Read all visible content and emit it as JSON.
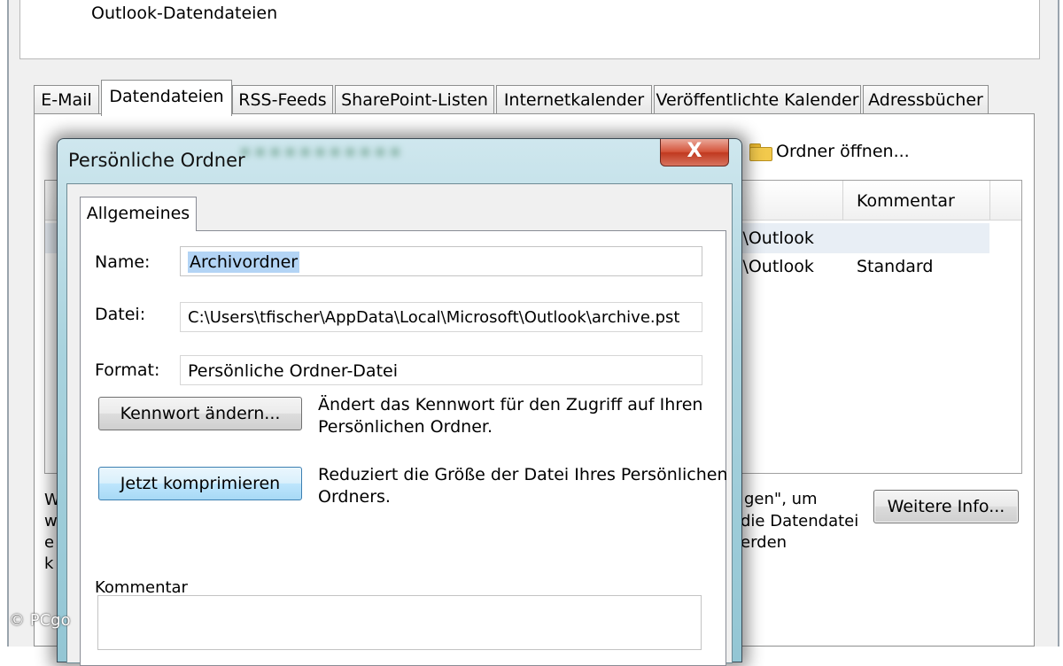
{
  "background_window": {
    "header_title": "Outlook-Datendateien",
    "tabs": [
      {
        "label": "E-Mail"
      },
      {
        "label": "Datendateien"
      },
      {
        "label": "RSS-Feeds"
      },
      {
        "label": "SharePoint-Listen"
      },
      {
        "label": "Internetkalender"
      },
      {
        "label": "Veröffentlichte Kalender"
      },
      {
        "label": "Adressbücher"
      }
    ],
    "active_tab": "Datendateien",
    "toolbar": {
      "open_folder_label": "Ordner öffnen..."
    },
    "list": {
      "column_comment": "Kommentar",
      "rows": [
        {
          "path_fragment": "t\\Outlook",
          "comment": ""
        },
        {
          "path_fragment": "t\\Outlook",
          "comment": "Standard"
        }
      ]
    },
    "info_fragments": {
      "line1": "gen\", um",
      "line2": "die Datendatei",
      "line3": "erden"
    },
    "left_fragments": [
      "W",
      "w",
      "e",
      "k"
    ],
    "more_info_button": "Weitere Info..."
  },
  "dialog": {
    "title": "Persönliche Ordner",
    "close_symbol": "X",
    "tab": "Allgemeines",
    "name_label": "Name:",
    "name_value": "Archivordner",
    "file_label": "Datei:",
    "file_value": "C:\\Users\\tfischer\\AppData\\Local\\Microsoft\\Outlook\\archive.pst",
    "format_label": "Format:",
    "format_value": "Persönliche Ordner-Datei",
    "change_password_button": "Kennwort ändern...",
    "change_password_desc_1": "Ändert das Kennwort für den Zugriff auf Ihren",
    "change_password_desc_2": "Persönlichen Ordner.",
    "compact_button": "Jetzt komprimieren",
    "compact_desc_1": "Reduziert die Größe der Datei Ihres Persönlichen",
    "compact_desc_2": "Ordners.",
    "comment_label": "Kommentar"
  },
  "watermark": "© PCgo"
}
